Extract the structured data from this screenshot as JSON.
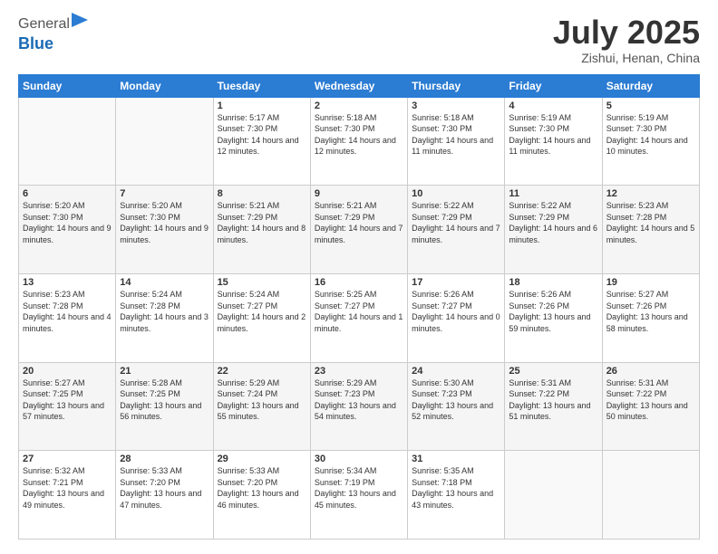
{
  "header": {
    "logo_line1": "General",
    "logo_line2": "Blue",
    "month": "July 2025",
    "location": "Zishui, Henan, China"
  },
  "weekdays": [
    "Sunday",
    "Monday",
    "Tuesday",
    "Wednesday",
    "Thursday",
    "Friday",
    "Saturday"
  ],
  "weeks": [
    [
      {
        "day": "",
        "info": ""
      },
      {
        "day": "",
        "info": ""
      },
      {
        "day": "1",
        "info": "Sunrise: 5:17 AM\nSunset: 7:30 PM\nDaylight: 14 hours and 12 minutes."
      },
      {
        "day": "2",
        "info": "Sunrise: 5:18 AM\nSunset: 7:30 PM\nDaylight: 14 hours and 12 minutes."
      },
      {
        "day": "3",
        "info": "Sunrise: 5:18 AM\nSunset: 7:30 PM\nDaylight: 14 hours and 11 minutes."
      },
      {
        "day": "4",
        "info": "Sunrise: 5:19 AM\nSunset: 7:30 PM\nDaylight: 14 hours and 11 minutes."
      },
      {
        "day": "5",
        "info": "Sunrise: 5:19 AM\nSunset: 7:30 PM\nDaylight: 14 hours and 10 minutes."
      }
    ],
    [
      {
        "day": "6",
        "info": "Sunrise: 5:20 AM\nSunset: 7:30 PM\nDaylight: 14 hours and 9 minutes."
      },
      {
        "day": "7",
        "info": "Sunrise: 5:20 AM\nSunset: 7:30 PM\nDaylight: 14 hours and 9 minutes."
      },
      {
        "day": "8",
        "info": "Sunrise: 5:21 AM\nSunset: 7:29 PM\nDaylight: 14 hours and 8 minutes."
      },
      {
        "day": "9",
        "info": "Sunrise: 5:21 AM\nSunset: 7:29 PM\nDaylight: 14 hours and 7 minutes."
      },
      {
        "day": "10",
        "info": "Sunrise: 5:22 AM\nSunset: 7:29 PM\nDaylight: 14 hours and 7 minutes."
      },
      {
        "day": "11",
        "info": "Sunrise: 5:22 AM\nSunset: 7:29 PM\nDaylight: 14 hours and 6 minutes."
      },
      {
        "day": "12",
        "info": "Sunrise: 5:23 AM\nSunset: 7:28 PM\nDaylight: 14 hours and 5 minutes."
      }
    ],
    [
      {
        "day": "13",
        "info": "Sunrise: 5:23 AM\nSunset: 7:28 PM\nDaylight: 14 hours and 4 minutes."
      },
      {
        "day": "14",
        "info": "Sunrise: 5:24 AM\nSunset: 7:28 PM\nDaylight: 14 hours and 3 minutes."
      },
      {
        "day": "15",
        "info": "Sunrise: 5:24 AM\nSunset: 7:27 PM\nDaylight: 14 hours and 2 minutes."
      },
      {
        "day": "16",
        "info": "Sunrise: 5:25 AM\nSunset: 7:27 PM\nDaylight: 14 hours and 1 minute."
      },
      {
        "day": "17",
        "info": "Sunrise: 5:26 AM\nSunset: 7:27 PM\nDaylight: 14 hours and 0 minutes."
      },
      {
        "day": "18",
        "info": "Sunrise: 5:26 AM\nSunset: 7:26 PM\nDaylight: 13 hours and 59 minutes."
      },
      {
        "day": "19",
        "info": "Sunrise: 5:27 AM\nSunset: 7:26 PM\nDaylight: 13 hours and 58 minutes."
      }
    ],
    [
      {
        "day": "20",
        "info": "Sunrise: 5:27 AM\nSunset: 7:25 PM\nDaylight: 13 hours and 57 minutes."
      },
      {
        "day": "21",
        "info": "Sunrise: 5:28 AM\nSunset: 7:25 PM\nDaylight: 13 hours and 56 minutes."
      },
      {
        "day": "22",
        "info": "Sunrise: 5:29 AM\nSunset: 7:24 PM\nDaylight: 13 hours and 55 minutes."
      },
      {
        "day": "23",
        "info": "Sunrise: 5:29 AM\nSunset: 7:23 PM\nDaylight: 13 hours and 54 minutes."
      },
      {
        "day": "24",
        "info": "Sunrise: 5:30 AM\nSunset: 7:23 PM\nDaylight: 13 hours and 52 minutes."
      },
      {
        "day": "25",
        "info": "Sunrise: 5:31 AM\nSunset: 7:22 PM\nDaylight: 13 hours and 51 minutes."
      },
      {
        "day": "26",
        "info": "Sunrise: 5:31 AM\nSunset: 7:22 PM\nDaylight: 13 hours and 50 minutes."
      }
    ],
    [
      {
        "day": "27",
        "info": "Sunrise: 5:32 AM\nSunset: 7:21 PM\nDaylight: 13 hours and 49 minutes."
      },
      {
        "day": "28",
        "info": "Sunrise: 5:33 AM\nSunset: 7:20 PM\nDaylight: 13 hours and 47 minutes."
      },
      {
        "day": "29",
        "info": "Sunrise: 5:33 AM\nSunset: 7:20 PM\nDaylight: 13 hours and 46 minutes."
      },
      {
        "day": "30",
        "info": "Sunrise: 5:34 AM\nSunset: 7:19 PM\nDaylight: 13 hours and 45 minutes."
      },
      {
        "day": "31",
        "info": "Sunrise: 5:35 AM\nSunset: 7:18 PM\nDaylight: 13 hours and 43 minutes."
      },
      {
        "day": "",
        "info": ""
      },
      {
        "day": "",
        "info": ""
      }
    ]
  ]
}
